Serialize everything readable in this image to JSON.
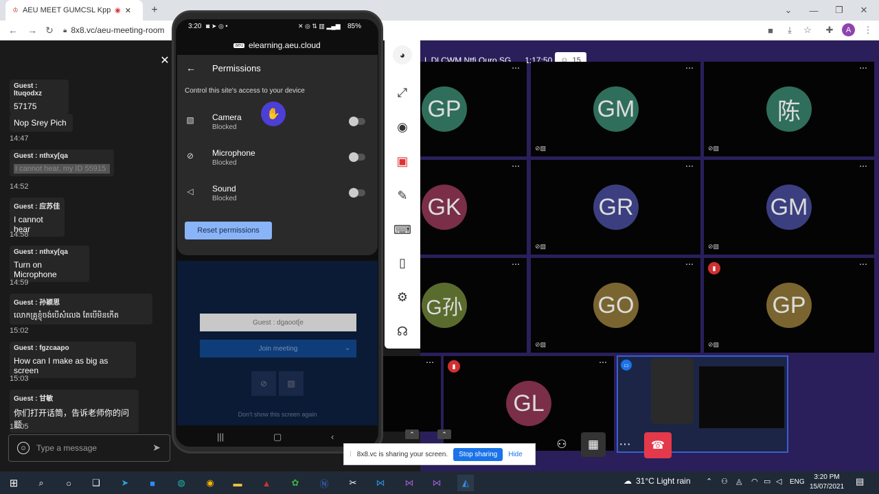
{
  "browser": {
    "tab_title": "AEU MEET GUMCSL Kppb N",
    "url": "8x8.vc/aeu-meeting-room",
    "avatar_letter": "A"
  },
  "chat": {
    "messages": [
      {
        "sender": "Guest : ltuqodxz",
        "text": "57175"
      },
      {
        "sender": "",
        "text": "Nop Srey Pich"
      },
      {
        "time": "14:47"
      },
      {
        "sender": "Guest : nthxy[qa",
        "text": "I cannot hear, my ID 55915"
      },
      {
        "time": "14:52"
      },
      {
        "sender": "Guest : 应苏佳",
        "text": "I cannot hear"
      },
      {
        "time": "14:58"
      },
      {
        "sender": "Guest : nthxy[qa",
        "text": "Turn on Microphone"
      },
      {
        "time": "14:59"
      },
      {
        "sender": "Guest : 孙颖思",
        "text": "លោកគ្រូខ្ញុំចង់បើសំលេង តែបើមិនកើត"
      },
      {
        "time": "15:02"
      },
      {
        "sender": "Guest : fgzcaapo",
        "text": "How can I make as big as screen"
      },
      {
        "time": "15:03"
      },
      {
        "sender": "Guest : 甘敏",
        "text": "你们打开话筒，告诉老师你的问题"
      },
      {
        "time": "15:05"
      }
    ],
    "input_placeholder": "Type a message"
  },
  "phone": {
    "status_time": "3:20",
    "battery": "85%",
    "host": "elearning.aeu.cloud",
    "permissions_title": "Permissions",
    "permissions_desc": "Control this site's access to your device",
    "permissions": [
      {
        "name": "Camera",
        "state": "Blocked",
        "icon": "camera-off-icon"
      },
      {
        "name": "Microphone",
        "state": "Blocked",
        "icon": "mic-off-icon"
      },
      {
        "name": "Sound",
        "state": "Blocked",
        "icon": "sound-off-icon"
      }
    ],
    "reset_label": "Reset permissions",
    "guest_name": "Guest : dgaoot[e",
    "join_label": "Join meeting",
    "dont_show": "Don't show this screen again"
  },
  "meeting": {
    "room_name": "L Dl CWM Ntfj Quro SG",
    "duration": "1:17:50",
    "participant_count": "15",
    "tiles": [
      {
        "initials": "GP",
        "color": "#2f6e5a"
      },
      {
        "initials": "GM",
        "color": "#2f6e5a"
      },
      {
        "initials": "陈",
        "color": "#2f6e5a"
      },
      {
        "initials": "GK",
        "color": "#7a2e47"
      },
      {
        "initials": "GR",
        "color": "#3b3f80"
      },
      {
        "initials": "GM",
        "color": "#3b3f80"
      },
      {
        "initials": "G孙",
        "color": "#5a6b2e"
      },
      {
        "initials": "GO",
        "color": "#7a6530"
      },
      {
        "initials": "GP",
        "color": "#7a6530"
      },
      {
        "initials": "GL",
        "color": "#7a2e47"
      }
    ]
  },
  "share_notice": {
    "text": "8x8.vc is sharing your screen.",
    "stop_label": "Stop sharing",
    "hide_label": "Hide"
  },
  "taskbar": {
    "weather": "31°C  Light rain",
    "lang": "ENG",
    "time": "3:20 PM",
    "date": "15/07/2021"
  }
}
